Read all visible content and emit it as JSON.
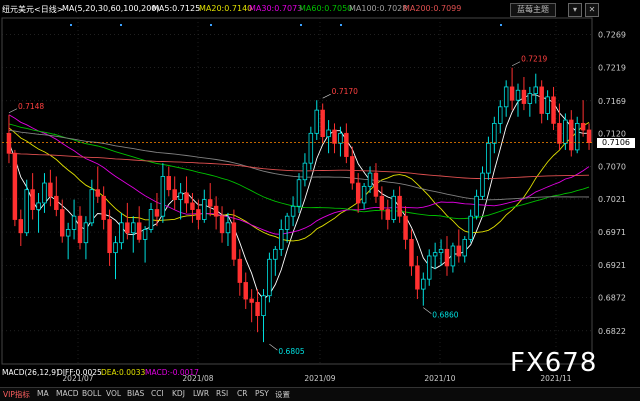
{
  "header": {
    "symbol": "纽元美元<日线>",
    "ma_params": "MA(5,20,30,60,100,200)",
    "ma5": "MA5:0.7125",
    "ma20": "MA20:0.7140",
    "ma30": "MA30:0.7073",
    "ma60": "MA60:0.7050",
    "ma100": "MA100:0.7028",
    "ma200": "MA200:0.7099",
    "theme_button": "蓝莓主题",
    "minimize": "▾",
    "close": "✕"
  },
  "colors": {
    "up": "#00e0e0",
    "down": "#ff3030",
    "ma5": "#ffffff",
    "ma20": "#e0e000",
    "ma30": "#e000e0",
    "ma60": "#00c000",
    "ma100": "#808080",
    "ma200": "#e05050",
    "grid": "#333333",
    "last_line": "#ff8800"
  },
  "chart_data": {
    "type": "candlestick",
    "y_ticks": [
      "0.7269",
      "0.7219",
      "0.7169",
      "0.7120",
      "0.7070",
      "0.7021",
      "0.6971",
      "0.6921",
      "0.6872",
      "0.6822"
    ],
    "ylim": [
      0.6772,
      0.7294
    ],
    "x_labels": [
      "2021/07",
      "2021/08",
      "2021/09",
      "2021/10",
      "2021/11"
    ],
    "last_price": "0.7106",
    "annotations": [
      {
        "label": "0.7219",
        "index": 85,
        "value": 0.7219,
        "side": "above"
      },
      {
        "label": "0.7170",
        "index": 53,
        "value": 0.717,
        "side": "above"
      },
      {
        "label": "0.7148",
        "index": 0,
        "value": 0.7148,
        "side": "above"
      },
      {
        "label": "0.6860",
        "index": 70,
        "value": 0.686,
        "side": "below"
      },
      {
        "label": "0.6805",
        "index": 44,
        "value": 0.6805,
        "side": "below"
      }
    ],
    "candles": [
      [
        0.712,
        0.7148,
        0.7075,
        0.709
      ],
      [
        0.709,
        0.7095,
        0.698,
        0.699
      ],
      [
        0.699,
        0.7005,
        0.695,
        0.697
      ],
      [
        0.697,
        0.705,
        0.6965,
        0.7035
      ],
      [
        0.7035,
        0.706,
        0.699,
        0.7005
      ],
      [
        0.7005,
        0.703,
        0.697,
        0.7015
      ],
      [
        0.7015,
        0.706,
        0.7,
        0.7045
      ],
      [
        0.7045,
        0.7065,
        0.701,
        0.7025
      ],
      [
        0.7025,
        0.7055,
        0.6995,
        0.7005
      ],
      [
        0.7005,
        0.702,
        0.6955,
        0.6965
      ],
      [
        0.6965,
        0.6985,
        0.693,
        0.6975
      ],
      [
        0.6975,
        0.702,
        0.696,
        0.6995
      ],
      [
        0.6995,
        0.701,
        0.6945,
        0.6955
      ],
      [
        0.6955,
        0.6995,
        0.693,
        0.6985
      ],
      [
        0.6985,
        0.705,
        0.698,
        0.7035
      ],
      [
        0.7035,
        0.707,
        0.7015,
        0.7025
      ],
      [
        0.7025,
        0.704,
        0.6975,
        0.699
      ],
      [
        0.699,
        0.7005,
        0.692,
        0.694
      ],
      [
        0.694,
        0.6965,
        0.69,
        0.6955
      ],
      [
        0.6955,
        0.7,
        0.6945,
        0.6985
      ],
      [
        0.6985,
        0.7015,
        0.696,
        0.697
      ],
      [
        0.697,
        0.6995,
        0.694,
        0.6985
      ],
      [
        0.6985,
        0.701,
        0.6955,
        0.696
      ],
      [
        0.696,
        0.698,
        0.6925,
        0.6975
      ],
      [
        0.6975,
        0.7015,
        0.697,
        0.7005
      ],
      [
        0.7005,
        0.703,
        0.698,
        0.6995
      ],
      [
        0.6995,
        0.7075,
        0.6985,
        0.7055
      ],
      [
        0.7055,
        0.707,
        0.7025,
        0.7035
      ],
      [
        0.7035,
        0.7055,
        0.7005,
        0.702
      ],
      [
        0.702,
        0.7045,
        0.699,
        0.703
      ],
      [
        0.703,
        0.7055,
        0.7,
        0.7015
      ],
      [
        0.7015,
        0.703,
        0.6985,
        0.7005
      ],
      [
        0.7005,
        0.702,
        0.6975,
        0.699
      ],
      [
        0.699,
        0.7035,
        0.6985,
        0.702
      ],
      [
        0.702,
        0.7045,
        0.6995,
        0.701
      ],
      [
        0.701,
        0.7025,
        0.6975,
        0.6995
      ],
      [
        0.6995,
        0.701,
        0.6955,
        0.697
      ],
      [
        0.697,
        0.7,
        0.695,
        0.6985
      ],
      [
        0.6985,
        0.7005,
        0.692,
        0.693
      ],
      [
        0.693,
        0.6945,
        0.6875,
        0.6895
      ],
      [
        0.6895,
        0.691,
        0.6855,
        0.687
      ],
      [
        0.687,
        0.6885,
        0.6835,
        0.6865
      ],
      [
        0.6865,
        0.6885,
        0.682,
        0.6845
      ],
      [
        0.6845,
        0.6885,
        0.6805,
        0.6875
      ],
      [
        0.6875,
        0.694,
        0.6865,
        0.693
      ],
      [
        0.693,
        0.695,
        0.6905,
        0.6945
      ],
      [
        0.6945,
        0.699,
        0.6935,
        0.6975
      ],
      [
        0.6975,
        0.7,
        0.6955,
        0.6995
      ],
      [
        0.6995,
        0.7025,
        0.698,
        0.701
      ],
      [
        0.701,
        0.706,
        0.7,
        0.705
      ],
      [
        0.705,
        0.709,
        0.704,
        0.7075
      ],
      [
        0.7075,
        0.713,
        0.7065,
        0.712
      ],
      [
        0.712,
        0.717,
        0.711,
        0.7155
      ],
      [
        0.7155,
        0.7165,
        0.7105,
        0.7115
      ],
      [
        0.7115,
        0.714,
        0.709,
        0.7125
      ],
      [
        0.7125,
        0.7135,
        0.709,
        0.7105
      ],
      [
        0.7105,
        0.713,
        0.7085,
        0.712
      ],
      [
        0.712,
        0.7135,
        0.7075,
        0.7085
      ],
      [
        0.7085,
        0.71,
        0.7035,
        0.7045
      ],
      [
        0.7045,
        0.706,
        0.7,
        0.7015
      ],
      [
        0.7015,
        0.7045,
        0.7005,
        0.704
      ],
      [
        0.704,
        0.707,
        0.703,
        0.706
      ],
      [
        0.706,
        0.7075,
        0.7015,
        0.7025
      ],
      [
        0.7025,
        0.704,
        0.699,
        0.7005
      ],
      [
        0.7005,
        0.702,
        0.6975,
        0.699
      ],
      [
        0.699,
        0.7035,
        0.6985,
        0.7025
      ],
      [
        0.7025,
        0.704,
        0.6985,
        0.6995
      ],
      [
        0.6995,
        0.701,
        0.6945,
        0.696
      ],
      [
        0.696,
        0.6975,
        0.6905,
        0.692
      ],
      [
        0.692,
        0.6935,
        0.687,
        0.6885
      ],
      [
        0.6885,
        0.691,
        0.686,
        0.69
      ],
      [
        0.69,
        0.6945,
        0.689,
        0.6935
      ],
      [
        0.6935,
        0.6955,
        0.6915,
        0.694
      ],
      [
        0.694,
        0.696,
        0.692,
        0.6945
      ],
      [
        0.6945,
        0.6965,
        0.6905,
        0.692
      ],
      [
        0.692,
        0.6955,
        0.691,
        0.695
      ],
      [
        0.695,
        0.6975,
        0.6925,
        0.6935
      ],
      [
        0.6935,
        0.6965,
        0.6925,
        0.696
      ],
      [
        0.696,
        0.7005,
        0.6955,
        0.6995
      ],
      [
        0.6995,
        0.7035,
        0.699,
        0.7025
      ],
      [
        0.7025,
        0.707,
        0.702,
        0.706
      ],
      [
        0.706,
        0.7115,
        0.705,
        0.7105
      ],
      [
        0.7105,
        0.7145,
        0.709,
        0.7135
      ],
      [
        0.7135,
        0.717,
        0.712,
        0.716
      ],
      [
        0.716,
        0.72,
        0.7145,
        0.719
      ],
      [
        0.719,
        0.7219,
        0.7155,
        0.717
      ],
      [
        0.717,
        0.7195,
        0.7145,
        0.7185
      ],
      [
        0.7185,
        0.7205,
        0.7155,
        0.7165
      ],
      [
        0.7165,
        0.719,
        0.7145,
        0.718
      ],
      [
        0.718,
        0.721,
        0.7165,
        0.719
      ],
      [
        0.719,
        0.72,
        0.7135,
        0.715
      ],
      [
        0.715,
        0.7185,
        0.714,
        0.7175
      ],
      [
        0.7175,
        0.719,
        0.7125,
        0.7135
      ],
      [
        0.7135,
        0.7165,
        0.7095,
        0.7105
      ],
      [
        0.7105,
        0.715,
        0.7095,
        0.714
      ],
      [
        0.714,
        0.7155,
        0.7085,
        0.7095
      ],
      [
        0.7095,
        0.7145,
        0.709,
        0.7135
      ],
      [
        0.7135,
        0.717,
        0.7115,
        0.7125
      ],
      [
        0.7125,
        0.7135,
        0.7095,
        0.7106
      ]
    ]
  },
  "macd": {
    "params": "MACD(26,12,9)",
    "diff": "DIFF:0.0025",
    "dea": "DEA:0.0033",
    "macd": "MACD:-0.0017"
  },
  "watermark": "FX678",
  "tabs": [
    "VIP指标",
    "MA",
    "MACD",
    "BOLL",
    "VOL",
    "BIAS",
    "CCI",
    "KDJ",
    "LWR",
    "RSI",
    "CR",
    "PSY",
    "设置"
  ]
}
